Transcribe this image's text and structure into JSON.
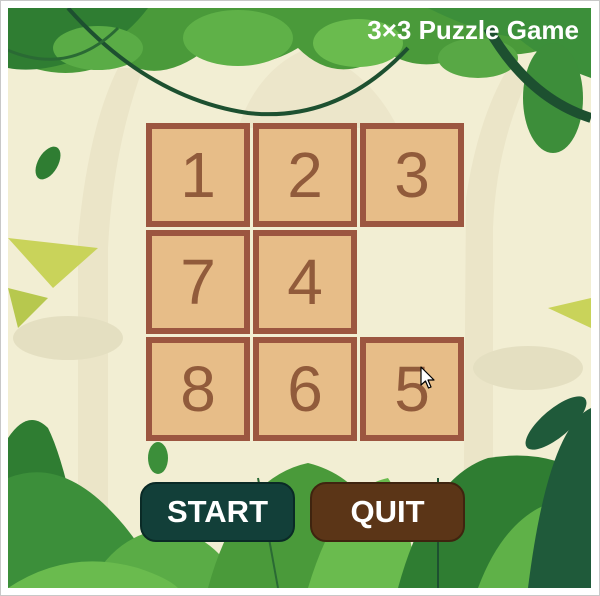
{
  "game": {
    "title": "3×3 Puzzle Game"
  },
  "board": {
    "rows": 3,
    "cols": 3,
    "tiles": [
      [
        "1",
        "2",
        "3"
      ],
      [
        "7",
        "4",
        ""
      ],
      [
        "8",
        "6",
        "5"
      ]
    ]
  },
  "buttons": {
    "start_label": "START",
    "quit_label": "QUIT"
  },
  "colors": {
    "tile_fill": "#e7bd88",
    "tile_border": "#9c5640",
    "tile_text": "#915b3b",
    "start_button": "#123f39",
    "quit_button": "#5b3517",
    "background": "#f2eed3"
  },
  "icons": {
    "cursor": "mouse-pointer-icon"
  }
}
